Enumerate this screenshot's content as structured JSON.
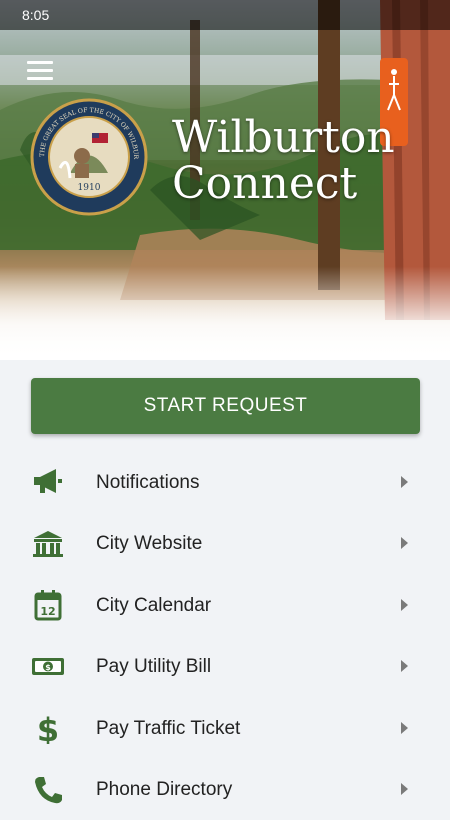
{
  "status_bar": {
    "time": "8:05"
  },
  "header": {
    "title_line1": "Wilburton",
    "title_line2": "Connect",
    "seal": {
      "top_text": "THE GREAT SEAL OF THE CITY OF WILBURTON, OKLAHOMA",
      "year": "1910"
    }
  },
  "start_request": {
    "label": "START REQUEST"
  },
  "menu": [
    {
      "label": "Notifications",
      "icon": "megaphone-icon"
    },
    {
      "label": "City Website",
      "icon": "city-hall-icon"
    },
    {
      "label": "City Calendar",
      "icon": "calendar-icon"
    },
    {
      "label": "Pay Utility Bill",
      "icon": "money-bill-icon"
    },
    {
      "label": "Pay Traffic Ticket",
      "icon": "dollar-sign-icon"
    },
    {
      "label": "Phone Directory",
      "icon": "phone-icon"
    }
  ],
  "colors": {
    "accent_green": "#4b7b42",
    "icon_green": "#3f6f35",
    "background": "#f1f3f6"
  }
}
